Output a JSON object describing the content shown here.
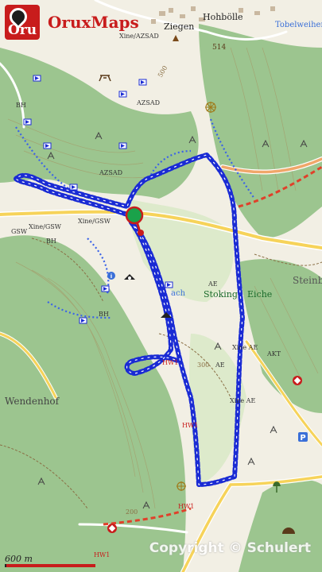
{
  "brand": {
    "logo_text": "Oru",
    "name": "OruxMaps"
  },
  "places": {
    "ziegen": "Ziegen",
    "hohbolle": "Hohbölle",
    "tobelweiher": "Tobelweiher",
    "steinbruch": "Steinbruc",
    "stoking": "Stoking",
    "eiche": "Eiche",
    "wendenhof": "Wendenhof",
    "bach": "ach"
  },
  "trail_labels": {
    "xine_azsad": "Xine/AZSAD",
    "azsad_1": "AZSAD",
    "azsad_2": "AZSAD",
    "xine_gsw_1": "Xine/GSW",
    "xine_gsw_2": "Xine/GSW",
    "gsw": "GSW",
    "bh_1": "BH",
    "bh_2": "BH",
    "bh_3": "BH",
    "hw1_1": "HW1",
    "hw1_2": "HW1",
    "hw1_3": "HW1",
    "hw1_4": "HW1",
    "xine_ae_1": "Xine AE",
    "xine_ae_2": "Xine AE",
    "ae_1": "AE",
    "ae_2": "AE",
    "akt": "AKT"
  },
  "elevations": {
    "e514": "514",
    "e500": "500",
    "e300": "300",
    "e200": "200"
  },
  "scale": {
    "label": "600 m",
    "meters": 600
  },
  "copyright": "Copyright © Schulert",
  "colors": {
    "route": "#1a2bd4",
    "forest": "#93c08a",
    "brand": "#c81c1c",
    "road": "#f6d35a"
  },
  "icons": [
    "parking-icon",
    "start-marker-icon",
    "viewpoint-icon",
    "picnic-icon",
    "hut-icon",
    "information-icon"
  ]
}
